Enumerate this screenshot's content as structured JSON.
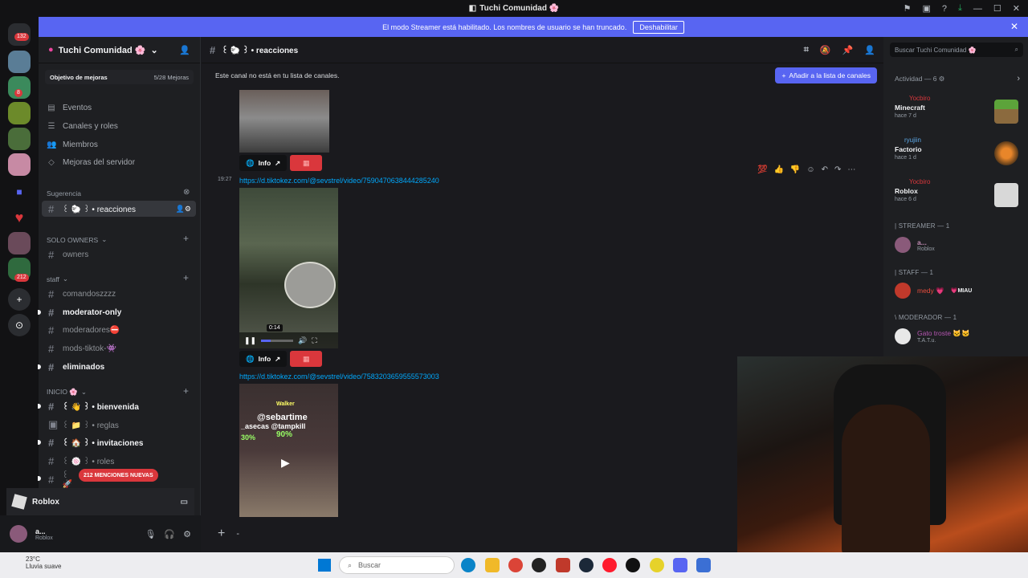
{
  "window": {
    "title": "Tuchi Comunidad 🌸"
  },
  "banner": {
    "text": "El modo Streamer está habilitado. Los nombres de usuario se han truncado.",
    "button": "Deshabilitar"
  },
  "rail": {
    "dm_badge": "132",
    "badges": [
      "8",
      "16",
      "212"
    ]
  },
  "server": {
    "name": "Tuchi Comunidad 🌸",
    "boost_label": "Objetivo de mejoras",
    "boost_count": "5/28 Mejoras"
  },
  "nav": [
    "Eventos",
    "Canales y roles",
    "Miembros",
    "Mejoras del servidor"
  ],
  "categories": {
    "suggestion": "Sugerencia",
    "solo_owners": "SOLO OWNERS",
    "staff": "staff",
    "inicio": "INICIO 🌸"
  },
  "channels": {
    "reacciones": "꒰ 🐑 ꒱ • reacciones",
    "owners": "owners",
    "comandos": "comandoszzzz",
    "moderator_only": "moderator-only",
    "moderadores": "moderadores⛔",
    "mods_tiktok": "mods-tiktok-👾",
    "eliminados": "eliminados",
    "bienvenida": "꒰ 👋 ꒱ • bienvenida",
    "reglas": "꒰ 📁 ꒱ • reglas",
    "invitaciones": "꒰ 🏠 ꒱ • invitaciones",
    "roles": "꒰ 🍥 ꒱ • roles",
    "partial": "꒰ 🚀"
  },
  "mentions": "212 MENCIONES NUEVAS",
  "activity_panel": {
    "game": "Roblox"
  },
  "user": {
    "name": "a...",
    "status": "Roblox"
  },
  "main": {
    "channel_title": "꒰ 🐑 ꒱ • reacciones",
    "notice": "Este canal no está en tu lista de canales.",
    "add_button": "Añadir a la lista de canales",
    "message_time": "19:27",
    "link1": "https://d.tiktokez.com/@sevstrel/video/7590470638444285240",
    "link2": "https://d.tiktokez.com/@sevstrel/video/7583203659555573003",
    "video_time": "0:14",
    "info_label": "Info",
    "meme_texts": [
      "Walker",
      "@sebartime",
      "_asecas @tampkill",
      "90%",
      "30%"
    ],
    "composer_placeholder": "-"
  },
  "right": {
    "search_placeholder": "Buscar Tuchi Comunidad 🌸",
    "activity_title": "Actividad — 6 ⚙",
    "activities": [
      {
        "who": "Yocbiro",
        "game": "Minecraft",
        "ago": "hace 7 d"
      },
      {
        "who": "ryujiin",
        "game": "Factorio",
        "ago": "hace 1 d"
      },
      {
        "who": "Yocbiro",
        "game": "Roblox",
        "ago": "hace 6 d"
      }
    ],
    "roles": [
      {
        "title": "| STREAMER — 1",
        "member": "a...",
        "status": "Roblox"
      },
      {
        "title": "| STAFF — 1",
        "member": "medy 💗",
        "status": "💗MIAU"
      },
      {
        "title": "\\ MODERADOR — 1",
        "member": "Gato troste 🐱🐱",
        "status": "T.A.T.u."
      }
    ]
  },
  "taskbar": {
    "temp": "23°C",
    "weather": "Lluvia suave",
    "search": "Buscar"
  },
  "colors": {
    "accent": "#5865f2",
    "danger": "#da373c",
    "link": "#00a8fc"
  }
}
